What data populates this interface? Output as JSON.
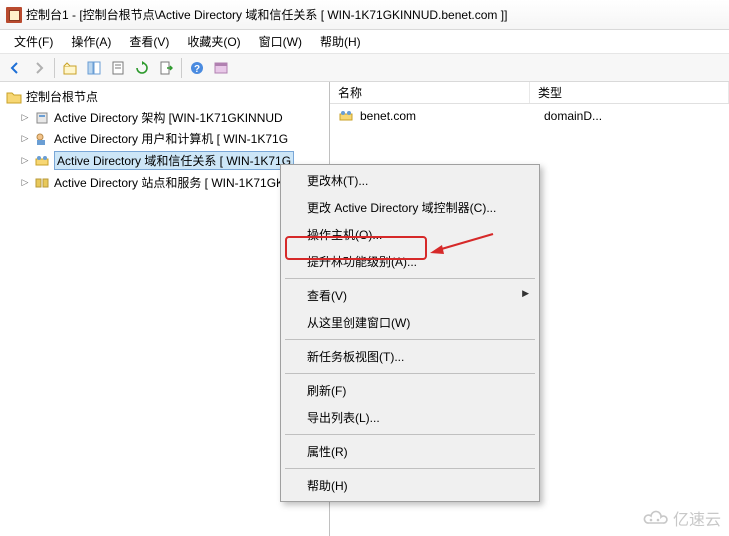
{
  "title": "控制台1 - [控制台根节点\\Active Directory 域和信任关系 [ WIN-1K71GKINNUD.benet.com ]]",
  "menu": {
    "file": "文件(F)",
    "action": "操作(A)",
    "view": "查看(V)",
    "favorites": "收藏夹(O)",
    "window": "窗口(W)",
    "help": "帮助(H)"
  },
  "tree": {
    "root": "控制台根节点",
    "items": [
      "Active Directory 架构 [WIN-1K71GKINNUD",
      "Active Directory 用户和计算机 [ WIN-1K71G",
      "Active Directory 域和信任关系 [ WIN-1K71G",
      "Active Directory 站点和服务 [ WIN-1K71GK"
    ]
  },
  "list": {
    "cols": {
      "name": "名称",
      "type": "类型"
    },
    "row": {
      "name": "benet.com",
      "type": "domainD..."
    }
  },
  "ctx": {
    "changeForest": "更改林(T)...",
    "changeDC": "更改 Active Directory 域控制器(C)...",
    "opsMaster": "操作主机(O)...",
    "raiseForest": "提升林功能级别(A)...",
    "view": "查看(V)",
    "newWindow": "从这里创建窗口(W)",
    "newTaskpad": "新任务板视图(T)...",
    "refresh": "刷新(F)",
    "exportList": "导出列表(L)...",
    "properties": "属性(R)",
    "help": "帮助(H)"
  },
  "watermark": "亿速云"
}
